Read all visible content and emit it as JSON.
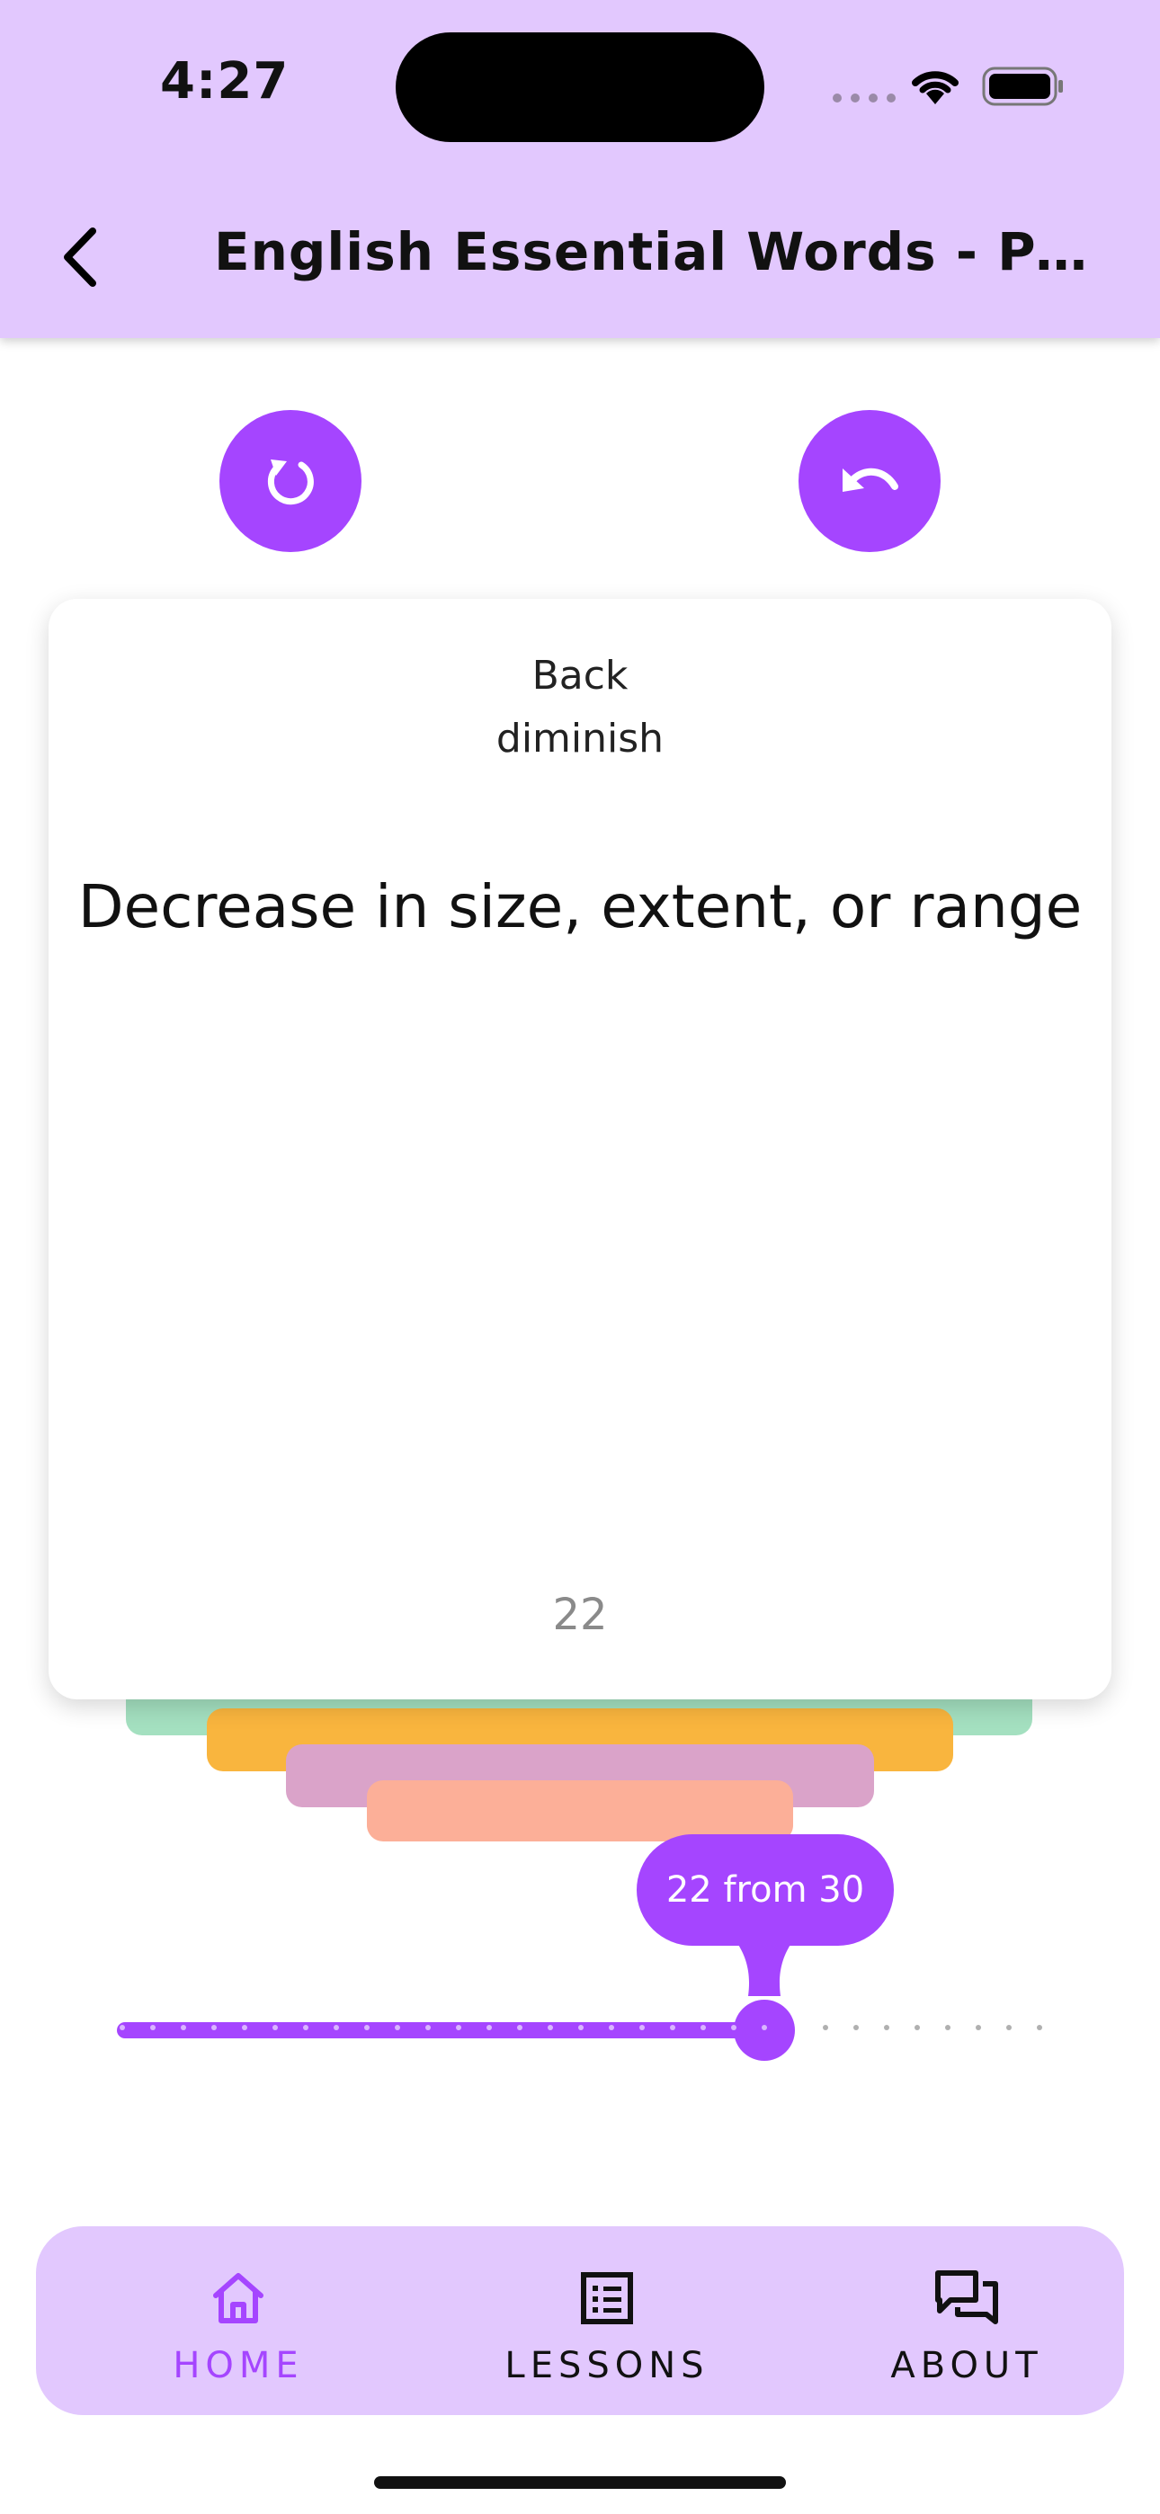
{
  "status_bar": {
    "time": "4:27"
  },
  "header": {
    "title": "English Essential Words - Part..."
  },
  "card": {
    "side": "Back",
    "word": "diminish",
    "definition": "Decrease in size, extent, or range",
    "number": "22"
  },
  "slider": {
    "label": "22 from 30",
    "value": 22,
    "max": 30
  },
  "nav": {
    "home": "HOME",
    "lessons": "LESSONS",
    "about": "ABOUT"
  },
  "colors": {
    "accent": "#a545ff",
    "header_bg": "#e2c8fe",
    "stack": [
      "#a4e0c0",
      "#f9b53e",
      "#daa3c9",
      "#fcaf98"
    ]
  },
  "icons": {
    "back": "chevron-left-icon",
    "reset": "refresh-icon",
    "undo": "undo-icon",
    "home": "home-icon",
    "lessons": "list-icon",
    "about": "chat-icon"
  }
}
